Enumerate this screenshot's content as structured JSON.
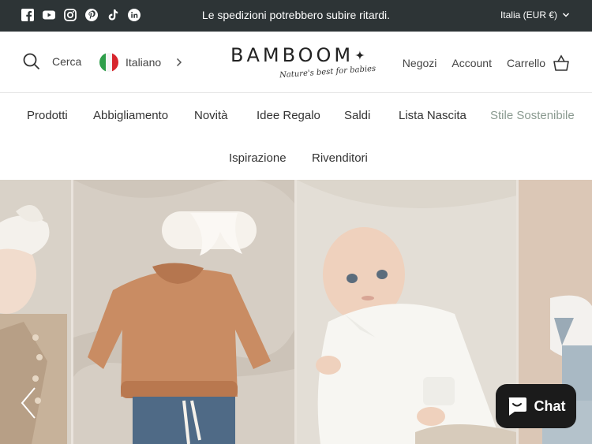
{
  "announcement": {
    "text": "Le spedizioni potrebbero subire ritardi.",
    "social_icons": [
      "facebook-icon",
      "youtube-icon",
      "instagram-icon",
      "pinterest-icon",
      "tiktok-icon",
      "linkedin-icon"
    ],
    "currency_selector": "Italia (EUR €)"
  },
  "header": {
    "search_label": "Cerca",
    "language_label": "Italiano",
    "logo_text": "BAMBOOM",
    "logo_tagline": "Nature's best for babies",
    "links": {
      "stores": "Negozi",
      "account": "Account",
      "cart": "Carrello"
    }
  },
  "main_nav": {
    "row1": [
      "Prodotti",
      "Abbigliamento",
      "Novità",
      "Idee Regalo",
      "Saldi",
      "Lista Nascita",
      "Stile Sostenibile"
    ],
    "row2": [
      "Ispirazione",
      "Rivenditori"
    ]
  },
  "chat": {
    "label": "Chat"
  },
  "colors": {
    "topbar": "#2d3436",
    "muted_link": "#8a9a90",
    "chat_bg": "#1b1b1b"
  }
}
